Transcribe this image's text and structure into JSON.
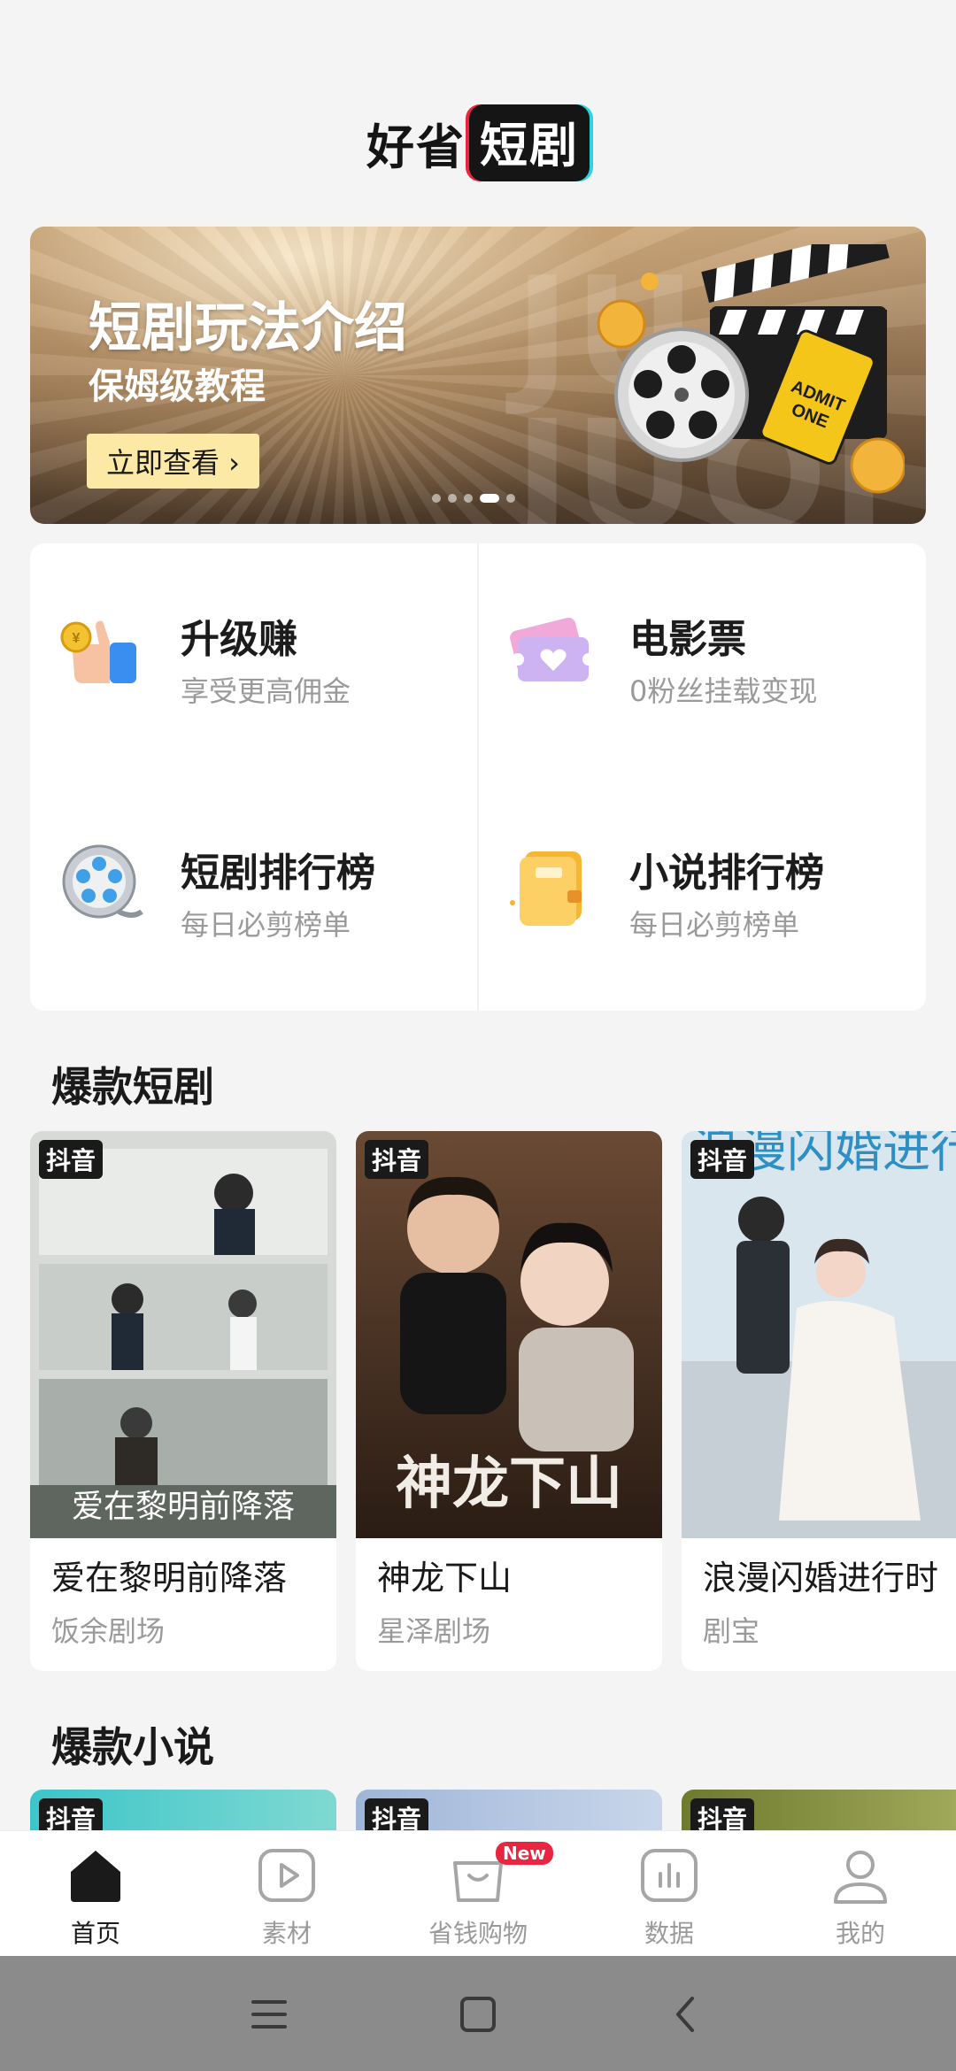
{
  "header": {
    "logo_part1": "好省",
    "logo_part2": "短剧"
  },
  "banner": {
    "title": "短剧玩法介绍",
    "subtitle": "保姆级教程",
    "cta": "立即查看 ›",
    "bg_word": "JU\nJUQI",
    "dots": 5,
    "active_dot": 3
  },
  "features": [
    {
      "name": "升级赚",
      "desc": "享受更高佣金",
      "icon": "thumbs-up-coin-icon"
    },
    {
      "name": "电影票",
      "desc": "0粉丝挂载变现",
      "icon": "ticket-icon"
    },
    {
      "name": "短剧排行榜",
      "desc": "每日必剪榜单",
      "icon": "film-reel-icon"
    },
    {
      "name": "小说排行榜",
      "desc": "每日必剪榜单",
      "icon": "notebook-icon"
    }
  ],
  "sections": {
    "dramas": "爆款短剧",
    "novels": "爆款小说"
  },
  "dramas": [
    {
      "badge": "抖音",
      "title": "爱在黎明前降落",
      "studio": "饭余剧场",
      "poster_text": "爱在黎明前降落"
    },
    {
      "badge": "抖音",
      "title": "神龙下山",
      "studio": "星泽剧场",
      "poster_text": "神龙下山"
    },
    {
      "badge": "抖音",
      "title": "浪漫闪婚进行时",
      "studio": "剧宝",
      "poster_text": "浪漫闪婚进行时"
    }
  ],
  "novels": [
    {
      "badge": "抖音"
    },
    {
      "badge": "抖音"
    },
    {
      "badge": "抖音"
    }
  ],
  "tabbar": {
    "tabs": [
      {
        "label": "首页",
        "icon": "home-icon",
        "active": true
      },
      {
        "label": "素材",
        "icon": "play-icon",
        "active": false
      },
      {
        "label": "省钱购物",
        "icon": "shopping-bag-icon",
        "active": false,
        "tag": "New"
      },
      {
        "label": "数据",
        "icon": "chart-icon",
        "active": false
      },
      {
        "label": "我的",
        "icon": "profile-icon",
        "active": false
      }
    ]
  },
  "system_nav": [
    "menu-icon",
    "home-square-icon",
    "back-icon"
  ]
}
